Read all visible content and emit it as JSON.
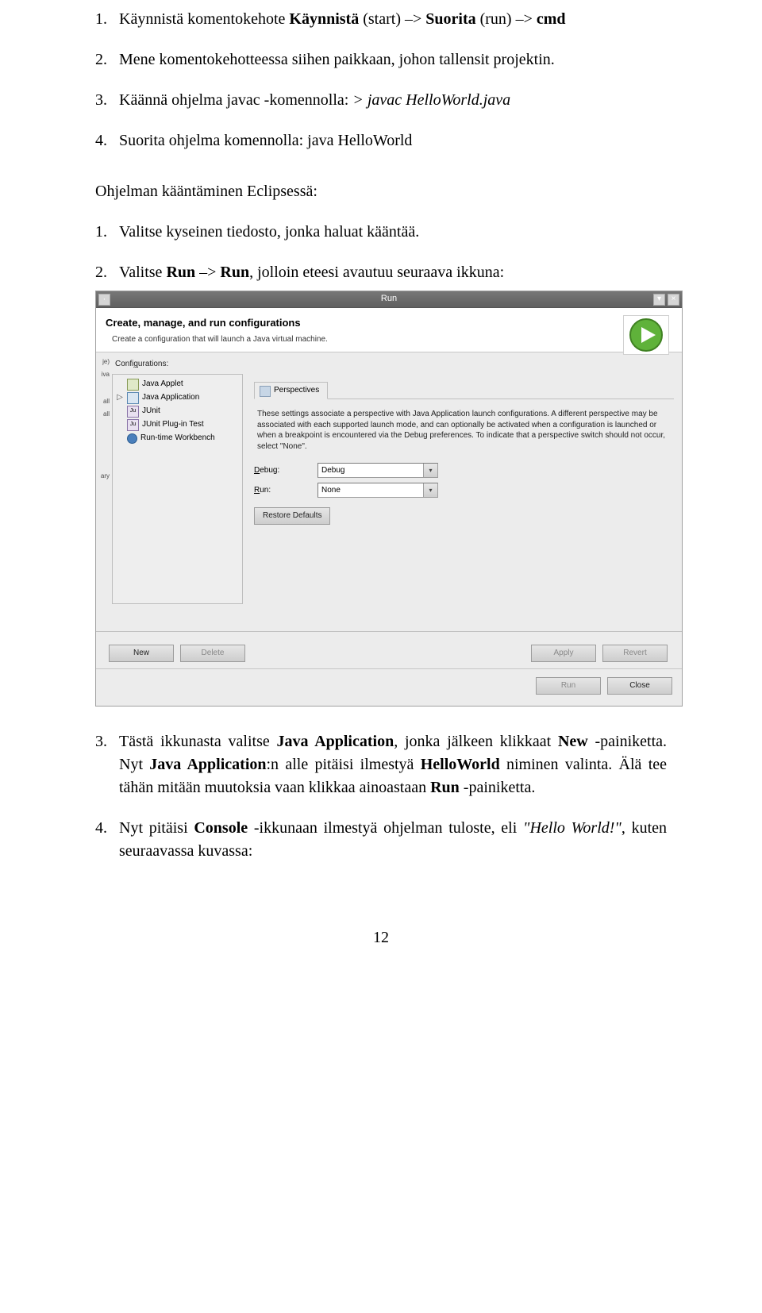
{
  "steps_cmd": [
    {
      "n": "1.",
      "pre": "Käynnistä komentokehote ",
      "bold1": "Käynnistä",
      "mid1": " (start) –> ",
      "bold2": "Suorita",
      "mid2": " (run) –> ",
      "bold3": "cmd"
    },
    {
      "n": "2.",
      "text": "Mene komentokehotteessa siihen paikkaan, johon tallensit projektin."
    },
    {
      "n": "3.",
      "pre": "Käännä ohjelma javac -komennolla: ",
      "italic": "> javac HelloWorld.java"
    },
    {
      "n": "4.",
      "text": "Suorita ohjelma komennolla: java HelloWorld"
    }
  ],
  "section_label": "Ohjelman kääntäminen Eclipsessä:",
  "steps_eclipse_a": [
    {
      "n": "1.",
      "text": "Valitse kyseinen tiedosto, jonka haluat kääntää."
    },
    {
      "n": "2.",
      "pre": "Valitse ",
      "bold1": "Run",
      "mid1": " –> ",
      "bold2": "Run",
      "post": ", jolloin eteesi avautuu seuraava ikkuna:"
    }
  ],
  "dialog": {
    "title": "Run",
    "headline": "Create, manage, and run configurations",
    "subhead": "Create a configuration that will launch a Java virtual machine.",
    "config_label_pre": "Confi",
    "config_label_u": "g",
    "config_label_post": "urations:",
    "config_items": [
      {
        "icon": "applet",
        "arrow": "",
        "label": "Java Applet"
      },
      {
        "icon": "javaapp",
        "arrow": "▷",
        "label": "Java Application"
      },
      {
        "icon": "junit",
        "arrow": "",
        "label": "JUnit"
      },
      {
        "icon": "junitp",
        "arrow": "",
        "label": "JUnit Plug-in Test"
      },
      {
        "icon": "runtime",
        "arrow": "",
        "label": "Run-time Workbench"
      }
    ],
    "tab_label": "Perspectives",
    "desc": "These settings associate a perspective with Java Application launch configurations. A different perspective may be associated with each supported launch mode, and can optionally be activated when a configuration is launched or when a breakpoint is encountered via the Debug preferences. To indicate that a perspective switch should not occur, select \"None\".",
    "debug_label_u": "D",
    "debug_label_rest": "ebug:",
    "debug_value": "Debug",
    "run_label_u": "R",
    "run_label_rest": "un:",
    "run_value": "None",
    "restore_btn": "Restore Defaults",
    "new_btn": "New",
    "delete_btn": "Delete",
    "apply_btn": "Apply",
    "revert_btn": "Revert",
    "run_btn": "Run",
    "close_btn": "Close"
  },
  "steps_eclipse_b": [
    {
      "n": "3.",
      "segs": [
        {
          "t": "Tästä ikkunasta valitse "
        },
        {
          "t": "Java Application",
          "b": true
        },
        {
          "t": ", jonka jälkeen klikkaat "
        },
        {
          "t": "New",
          "b": true
        },
        {
          "t": " -painiketta. Nyt "
        },
        {
          "t": "Java Application",
          "b": true
        },
        {
          "t": ":n alle pitäisi ilmestyä "
        },
        {
          "t": "HelloWorld",
          "b": true
        },
        {
          "t": " niminen valinta. Älä tee tähän mitään muutoksia vaan klikkaa ainoastaan "
        },
        {
          "t": "Run",
          "b": true
        },
        {
          "t": " -painiketta."
        }
      ]
    },
    {
      "n": "4.",
      "segs": [
        {
          "t": "Nyt pitäisi "
        },
        {
          "t": "Console",
          "b": true
        },
        {
          "t": " -ikkunaan ilmestyä ohjelman tuloste, eli "
        },
        {
          "t": "\"Hello World!\"",
          "i": true
        },
        {
          "t": ", kuten seuraavassa kuvassa:"
        }
      ]
    }
  ],
  "pagenum": "12"
}
